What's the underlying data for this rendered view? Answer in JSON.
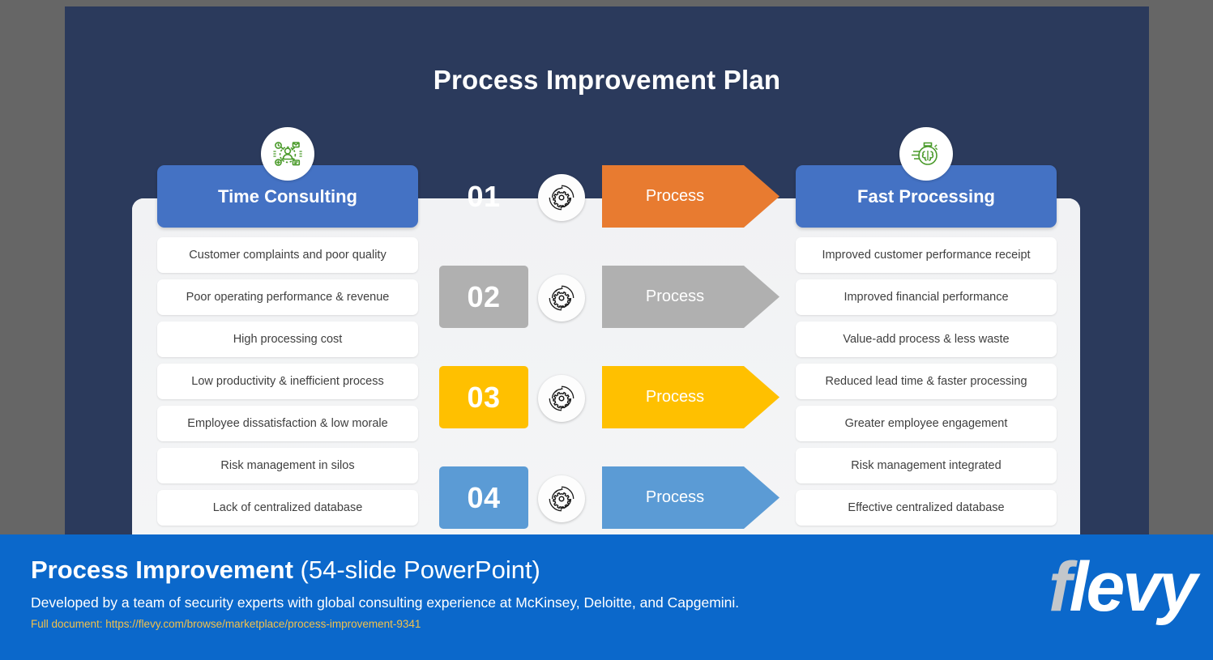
{
  "slide": {
    "title": "Process Improvement Plan",
    "background_color": "#2b3a5c",
    "panel_color": "#f2f3f5"
  },
  "columns": {
    "left": {
      "header": "Time Consulting",
      "header_color": "#4472c4",
      "icon": "network-person-icon",
      "icon_color": "#4a9a2a",
      "items": [
        "Customer complaints and poor quality",
        "Poor operating performance & revenue",
        "High processing cost",
        "Low productivity & inefficient process",
        "Employee dissatisfaction & low morale",
        "Risk management in silos",
        "Lack of centralized database"
      ]
    },
    "right": {
      "header": "Fast Processing",
      "header_color": "#4472c4",
      "icon": "stopwatch-brain-icon",
      "icon_color": "#4a9a2a",
      "items": [
        "Improved customer performance receipt",
        "Improved financial performance",
        "Value-add process & less waste",
        "Reduced lead time & faster processing",
        "Greater employee engagement",
        "Risk management integrated",
        "Effective centralized database"
      ]
    }
  },
  "process_rows": [
    {
      "number": "01",
      "label": "Process",
      "color": "#e87b30",
      "icon": "gear-cycle-icon"
    },
    {
      "number": "02",
      "label": "Process",
      "color": "#b0b0b0",
      "icon": "gear-cycle-icon"
    },
    {
      "number": "03",
      "label": "Process",
      "color": "#ffc000",
      "icon": "gear-cycle-icon"
    },
    {
      "number": "04",
      "label": "Process",
      "color": "#5b9bd5",
      "icon": "gear-cycle-icon"
    }
  ],
  "footer": {
    "title_bold": "Process Improvement",
    "title_rest": " (54-slide PowerPoint)",
    "subtitle": "Developed by a team of security experts with global consulting experience at McKinsey, Deloitte, and Capgemini.",
    "url": "Full document: https://flevy.com/browse/marketplace/process-improvement-9341",
    "logo_first": "f",
    "logo_rest": "levy",
    "background_color": "#0b68cb",
    "url_color": "#f2c14b"
  }
}
